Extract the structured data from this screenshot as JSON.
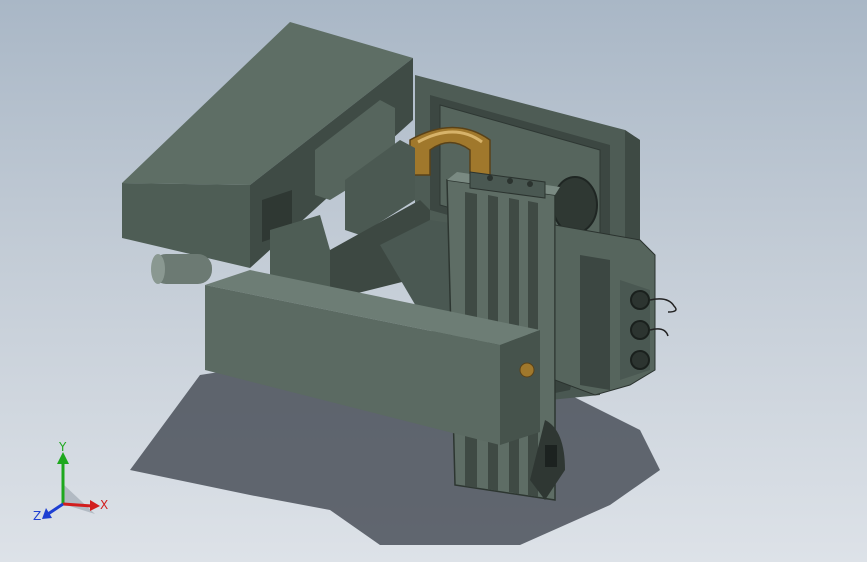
{
  "viewport": {
    "background_top": "#a9b7c6",
    "background_bottom": "#dde2e8"
  },
  "model": {
    "body_color": "#5b6b62",
    "dark_color": "#3a4540",
    "light_color": "#7d8f86",
    "bronze_color": "#a0782c",
    "shadow_color": "#3f4650"
  },
  "triad": {
    "x_label": "X",
    "y_label": "Y",
    "z_label": "Z",
    "x_color": "#d21e1e",
    "y_color": "#1ea81e",
    "z_color": "#1e3fd2"
  }
}
